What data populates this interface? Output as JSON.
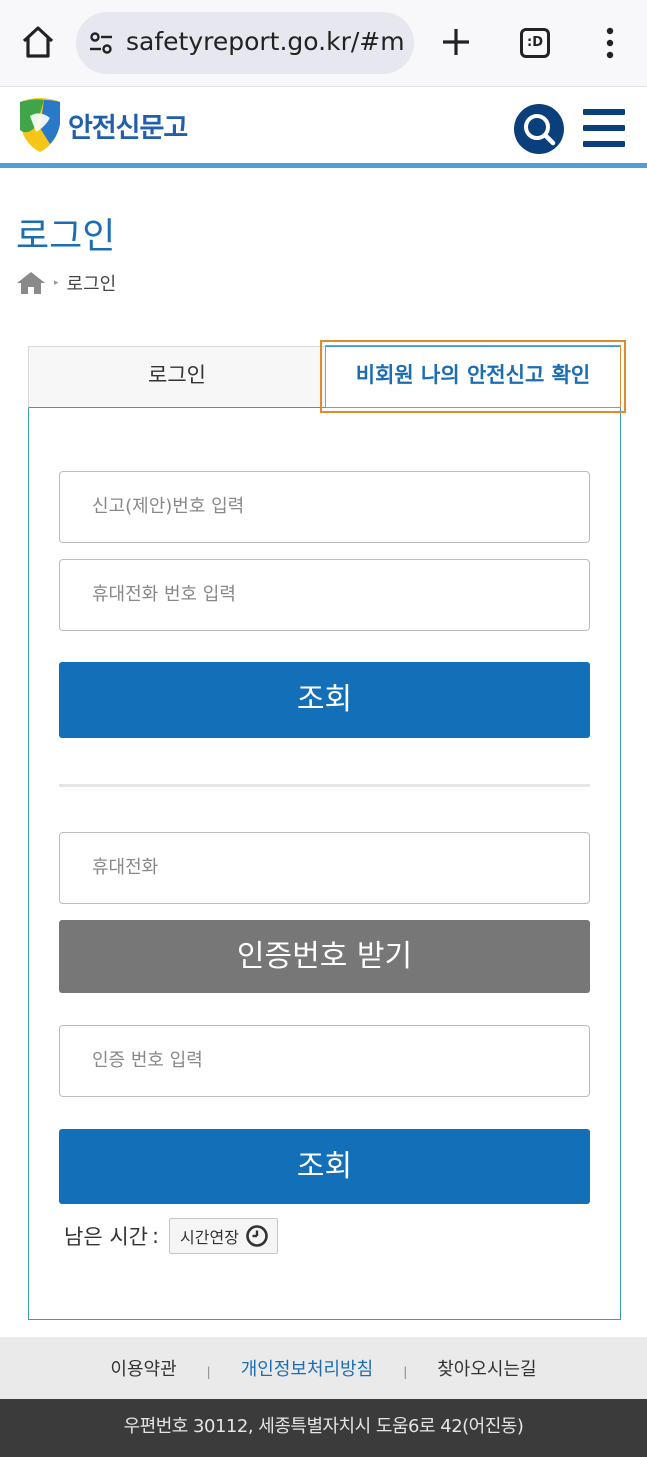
{
  "browser": {
    "url": "safetyreport.go.kr/#m",
    "tabs_label": ":D"
  },
  "header": {
    "logo_text": "안전신문고"
  },
  "page": {
    "title": "로그인",
    "breadcrumb": "로그인"
  },
  "tabs": {
    "login": "로그인",
    "guest": "비회원 나의 안전신고 확인"
  },
  "form": {
    "report_no_placeholder": "신고(제안)번호 입력",
    "phone_placeholder": "휴대전화 번호 입력",
    "search_label_1": "조회",
    "mobile_placeholder": "휴대전화",
    "get_code_label": "인증번호 받기",
    "code_placeholder": "인증 번호 입력",
    "search_label_2": "조회",
    "remaining_label": "남은 시간",
    "remaining_colon": ":",
    "extend_label": "시간연장"
  },
  "footer": {
    "terms": "이용약관",
    "privacy": "개인정보처리방침",
    "directions": "찾아오시는길",
    "separator": "|",
    "address": "우편번호 30112, 세종특별자치시 도움6로 42(어진동)"
  },
  "colors": {
    "brand_blue": "#136fb8",
    "title_blue": "#1c6eb4",
    "highlight_orange": "#de8a2f",
    "gray_button": "#777777"
  }
}
